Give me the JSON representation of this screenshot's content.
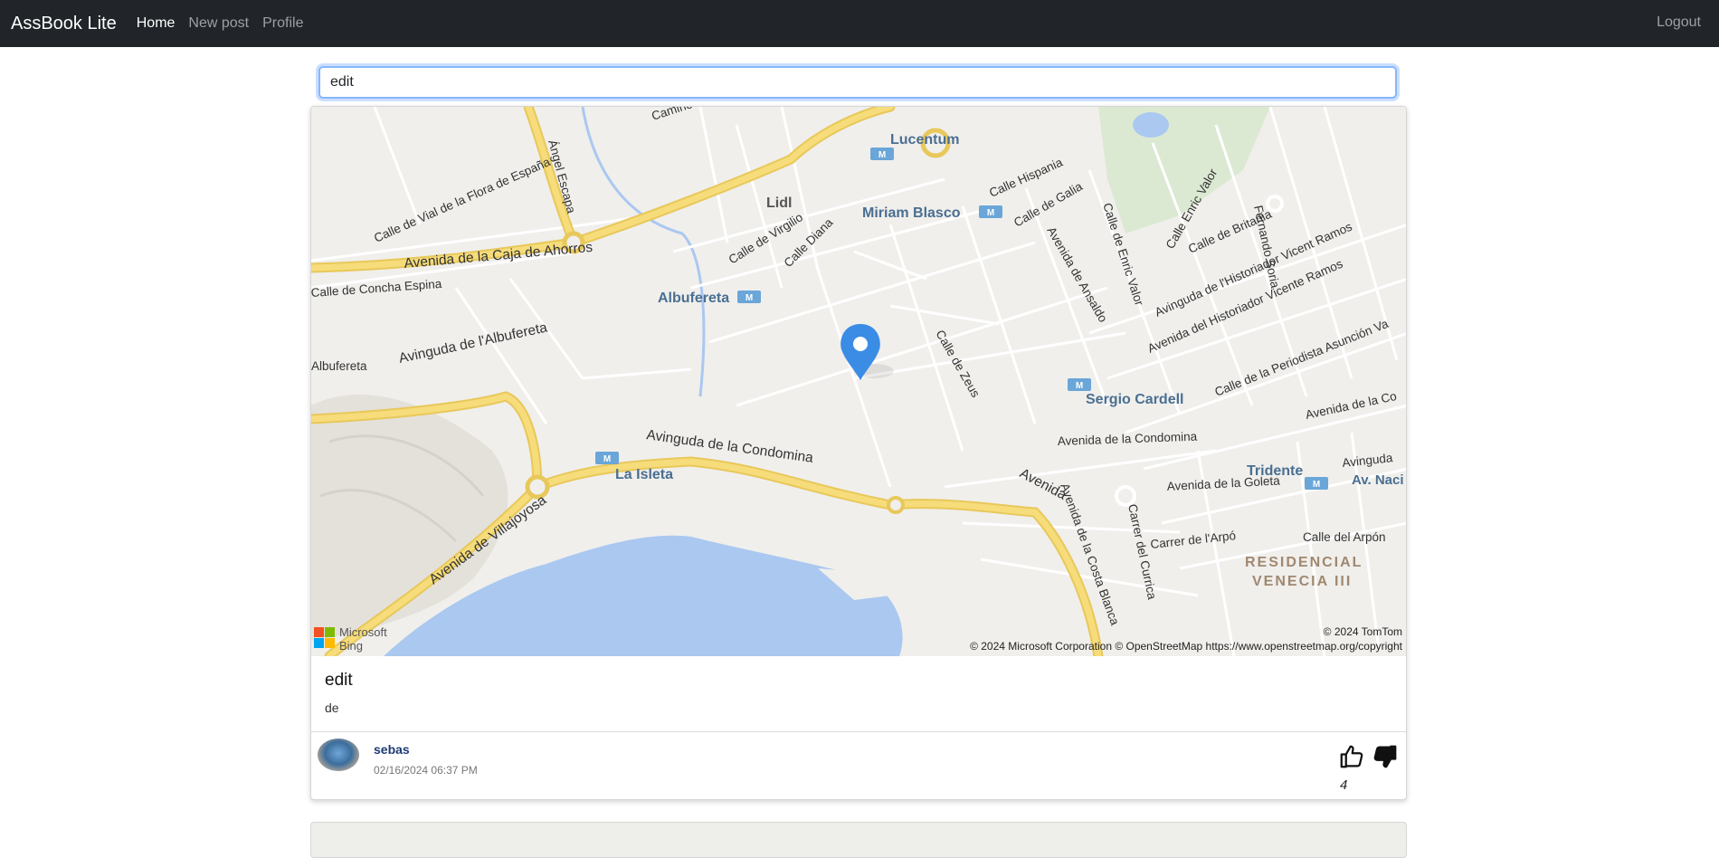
{
  "nav": {
    "brand": "AssBook Lite",
    "links": [
      "Home",
      "New post",
      "Profile"
    ],
    "logout": "Logout"
  },
  "search": {
    "value": "edit"
  },
  "post": {
    "title": "edit",
    "body": "de",
    "author": "sebas",
    "date": "02/16/2024 06:37 PM",
    "votes": "4",
    "map": {
      "streets": [
        "Calle de Vial de la Flora de España",
        "Ángel Escapa",
        "Avenida de la Caja de Ahorros",
        "Calle de Virgilio",
        "Calle Diana",
        "Calle Hispania",
        "Calle de Galia",
        "Avenida de Ansaldo",
        "Calle de Enric Valor",
        "Calle Enric Valor",
        "Fernando Soria",
        "Calle de Britania",
        "Avinguda de l'Historiador Vicent Ramos",
        "Avenida del Historiador Vicente Ramos",
        "Calle de Concha Espina",
        "Albufereta",
        "Avinguda de l'Albufereta",
        "Calle de Zeus",
        "Calle de la Periodista Asunción Va",
        "Avenida de la Co",
        "Avinguda de la Condomina",
        "Avenida de la Condomina",
        "Avenida",
        "Avenida de la Goleta",
        "Avinguda",
        "Av. Naci",
        "Carrer del Currica",
        "Carrer de l'Arpó",
        "Calle del Arpón",
        "Avenida de la Costa Blanca",
        "Avenida de Villajoyosa",
        "Camino"
      ],
      "places": [
        "Lucentum",
        "Lidl",
        "Miriam Blasco",
        "Albufereta",
        "Sergio Cardell",
        "La Isleta",
        "Tridente",
        "RESIDENCIAL",
        "VENECIA III"
      ],
      "metro_badge": "M",
      "logo_text": [
        "Microsoft",
        "Bing"
      ],
      "copyright_tomtom": "© 2024 TomTom",
      "copyright": "© 2024 Microsoft Corporation © OpenStreetMap https://www.openstreetmap.org/copyright",
      "colors": {
        "land": "#f0efec",
        "water": "#aac8f0",
        "major_road": "#f6dc7a",
        "pin": "#3b8ce5"
      }
    }
  }
}
